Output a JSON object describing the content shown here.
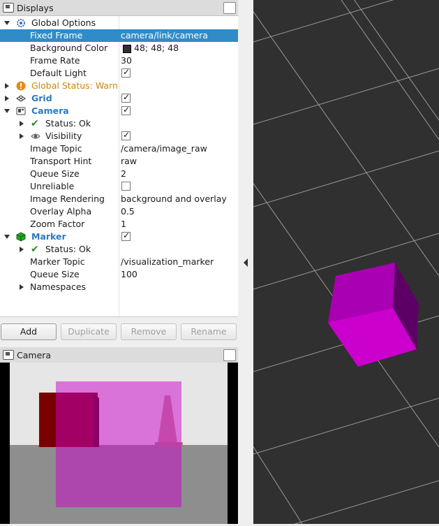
{
  "displays_panel": {
    "title": "Displays",
    "rows": [
      {
        "name": "Global Options",
        "value": ""
      },
      {
        "name": "Fixed Frame",
        "value": "camera/link/camera"
      },
      {
        "name": "Background Color",
        "value": "48; 48; 48"
      },
      {
        "name": "Frame Rate",
        "value": "30"
      },
      {
        "name": "Default Light",
        "value": ""
      },
      {
        "name": "Global Status: Warn",
        "value": ""
      },
      {
        "name": "Grid",
        "value": ""
      },
      {
        "name": "Camera",
        "value": ""
      },
      {
        "name": "Status: Ok",
        "value": ""
      },
      {
        "name": "Visibility",
        "value": ""
      },
      {
        "name": "Image Topic",
        "value": "/camera/image_raw"
      },
      {
        "name": "Transport Hint",
        "value": "raw"
      },
      {
        "name": "Queue Size",
        "value": "2"
      },
      {
        "name": "Unreliable",
        "value": ""
      },
      {
        "name": "Image Rendering",
        "value": "background and overlay"
      },
      {
        "name": "Overlay Alpha",
        "value": "0.5"
      },
      {
        "name": "Zoom Factor",
        "value": "1"
      },
      {
        "name": "Marker",
        "value": ""
      },
      {
        "name": "Status: Ok",
        "value": ""
      },
      {
        "name": "Marker Topic",
        "value": "/visualization_marker"
      },
      {
        "name": "Queue Size",
        "value": "100"
      },
      {
        "name": "Namespaces",
        "value": ""
      }
    ],
    "checkboxes": {
      "default_light": true,
      "grid": true,
      "camera": true,
      "visibility": true,
      "unreliable": false,
      "marker": true
    },
    "buttons": {
      "add": "Add",
      "duplicate": "Duplicate",
      "remove": "Remove",
      "rename": "Rename"
    }
  },
  "camera_panel": {
    "title": "Camera"
  },
  "colors": {
    "selection": "#308cc6",
    "background_3d": "#303030",
    "marker": "#cc00cc",
    "warn": "#c9860c",
    "display_name": "#2a7ac0"
  },
  "icons": [
    "monitor-icon",
    "gear-icon",
    "warning-icon",
    "grid-icon",
    "camera-icon",
    "checkmark-icon",
    "eye-icon",
    "cube-icon"
  ]
}
